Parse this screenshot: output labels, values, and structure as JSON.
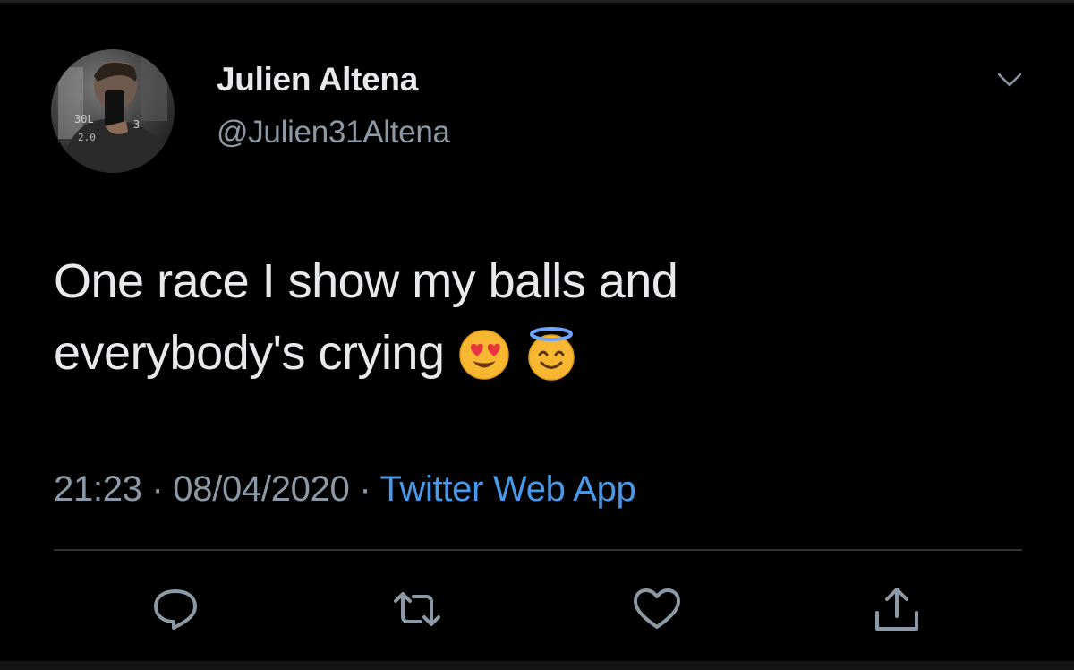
{
  "tweet": {
    "author": {
      "display_name": "Julien Altena",
      "handle": "@Julien31Altena"
    },
    "text_lines": [
      "One race I show my balls and",
      "everybody's crying"
    ],
    "emojis": [
      "heart-eyes-emoji",
      "halo-emoji"
    ],
    "meta": {
      "time": "21:23",
      "separator": "·",
      "date": "08/04/2020",
      "source": "Twitter Web App"
    },
    "actions": [
      "reply-icon",
      "retweet-icon",
      "like-icon",
      "share-icon"
    ],
    "colors": {
      "background": "#000000",
      "text": "#e7e9ea",
      "muted": "#8b98a5",
      "link": "#4a99e9"
    }
  }
}
